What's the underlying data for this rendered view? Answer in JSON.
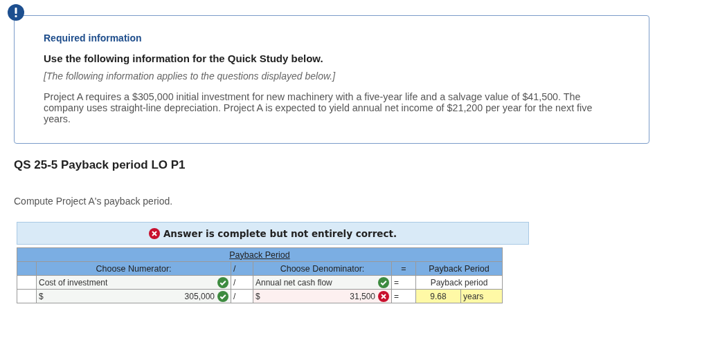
{
  "notice": {
    "heading": "Required information",
    "subheading": "Use the following information for the Quick Study below.",
    "note": "[The following information applies to the questions displayed below.]",
    "body": "Project A requires a $305,000 initial investment for new machinery with a five-year life and a salvage value of $41,500. The company uses straight-line depreciation. Project A is expected to yield annual net income of $21,200 per year for the next five years."
  },
  "question": {
    "title": "QS 25-5 Payback period LO P1",
    "prompt": "Compute Project A's payback period."
  },
  "feedback": {
    "correct": false,
    "message": "Answer is complete but not entirely correct."
  },
  "table": {
    "title": "Payback Period",
    "header": {
      "numerator": "Choose Numerator:",
      "divider": "/",
      "denominator": "Choose Denominator:",
      "equals": "=",
      "result": "Payback Period"
    },
    "label_row": {
      "numerator": "Cost of investment",
      "numerator_correct": true,
      "divider": "/",
      "denominator": "Annual net cash flow",
      "denominator_correct": true,
      "equals": "=",
      "result": "Payback period"
    },
    "value_row": {
      "numerator_prefix": "$",
      "numerator": "305,000",
      "numerator_correct": true,
      "divider": "/",
      "denominator_prefix": "$",
      "denominator": "31,500",
      "denominator_correct": false,
      "equals": "=",
      "result": "9.68",
      "unit": "years"
    }
  }
}
